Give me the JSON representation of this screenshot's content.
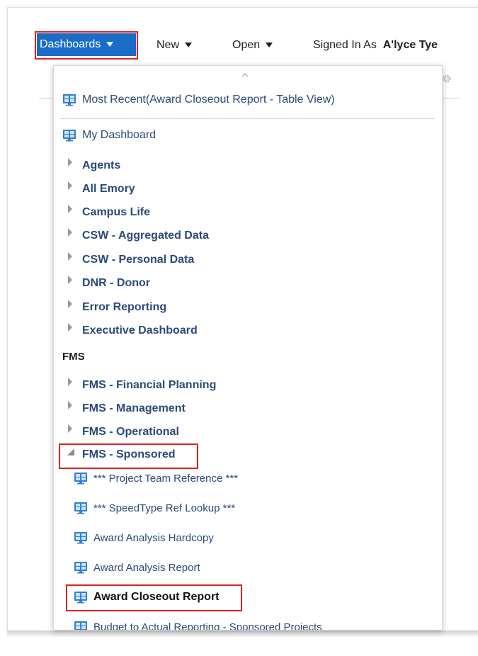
{
  "topbar": {
    "dashboards_label": "Dashboards",
    "new_label": "New",
    "open_label": "Open",
    "signed_in_label": "Signed In As",
    "signed_in_user": "A'lyce Tye"
  },
  "menu": {
    "most_recent": "Most Recent(Award Closeout Report - Table View)",
    "my_dashboard": "My Dashboard",
    "folders": [
      "Agents",
      "All Emory",
      "Campus Life",
      "CSW - Aggregated Data",
      "CSW - Personal Data",
      "DNR - Donor",
      "Error Reporting",
      "Executive Dashboard"
    ],
    "group_label": "FMS",
    "fms_folders": [
      "FMS - Financial Planning",
      "FMS - Management",
      "FMS - Operational"
    ],
    "expanded_folder": "FMS - Sponsored",
    "sponsored_items": [
      "*** Project Team Reference ***",
      "*** SpeedType Ref Lookup ***",
      "Award Analysis Hardcopy",
      "Award Analysis Report",
      "Award Closeout Report",
      "Budget to Actual Reporting - Sponsored Projects"
    ]
  },
  "colors": {
    "accent": "#1a6cc6",
    "highlight": "#e01e1e",
    "link_text": "#2a4a7a"
  }
}
